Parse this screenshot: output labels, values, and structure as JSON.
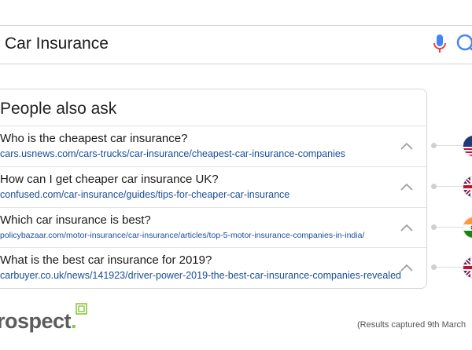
{
  "search": {
    "query": "Car Insurance"
  },
  "paa": {
    "title": "People also ask",
    "items": [
      {
        "question": "Who is the cheapest car insurance?",
        "url": "cars.usnews.com/cars-trucks/car-insurance/cheapest-car-insurance-companies",
        "flag": "us-flag-icon"
      },
      {
        "question": "How can I get cheaper car insurance UK?",
        "url": "confused.com/car-insurance/guides/tips-for-cheaper-car-insurance",
        "flag": "uk-flag-icon"
      },
      {
        "question": "Which car insurance is best?",
        "url": "policybazaar.com/motor-insurance/car-insurance/articles/top-5-motor-insurance-companies-in-india/",
        "flag": "india-flag-icon"
      },
      {
        "question": "What is the best car insurance for 2019?",
        "url": "carbuyer.co.uk/news/141923/driver-power-2019-the-best-car-insurance-companies-revealed",
        "flag": "uk-flag-icon"
      }
    ]
  },
  "footer": {
    "brand": "rospect",
    "brand_dot": ".",
    "note": "(Results captured 9th March"
  },
  "colors": {
    "link": "#1a4d99",
    "brand_green": "#8cc63f",
    "mic_blue": "#4285f4",
    "mic_red": "#ea4335"
  }
}
